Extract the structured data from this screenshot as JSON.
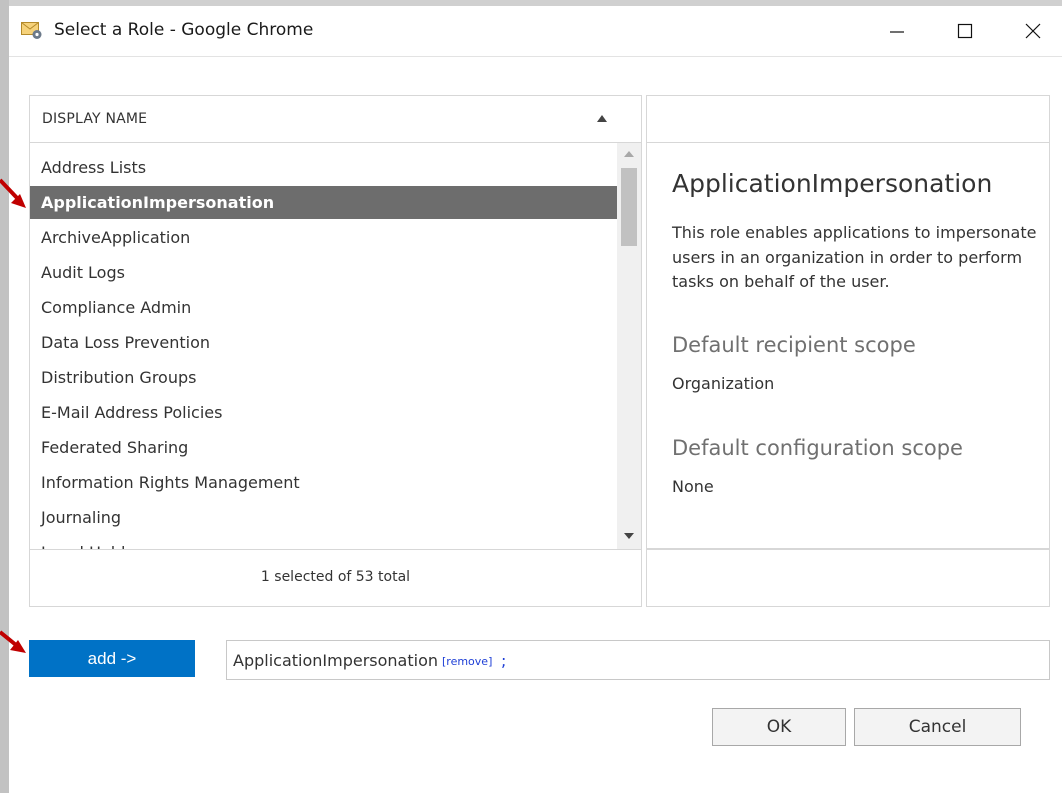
{
  "window": {
    "title": "Select a Role - Google Chrome",
    "icon": "role-envelope-gear-icon"
  },
  "list": {
    "column_header": "DISPLAY NAME",
    "sort": "ascending",
    "items": [
      "Address Lists",
      "ApplicationImpersonation",
      "ArchiveApplication",
      "Audit Logs",
      "Compliance Admin",
      "Data Loss Prevention",
      "Distribution Groups",
      "E-Mail Address Policies",
      "Federated Sharing",
      "Information Rights Management",
      "Journaling",
      "Legal Hold"
    ],
    "selected_item": "ApplicationImpersonation",
    "status": "1 selected of 53 total"
  },
  "details": {
    "title": "ApplicationImpersonation",
    "description": "This role enables applications to impersonate users in an organization in order to perform tasks on behalf of the user.",
    "recipient_scope_label": "Default recipient scope",
    "recipient_scope_value": "Organization",
    "config_scope_label": "Default configuration scope",
    "config_scope_value": "None"
  },
  "selection": {
    "add_label": "add ->",
    "selected_value": "ApplicationImpersonation",
    "remove_label": "[remove]",
    "separator": ";"
  },
  "actions": {
    "ok_label": "OK",
    "cancel_label": "Cancel"
  },
  "colors": {
    "accent": "#0072c6",
    "selected_row": "#6d6d6d",
    "annotation_arrow": "#c00000"
  }
}
